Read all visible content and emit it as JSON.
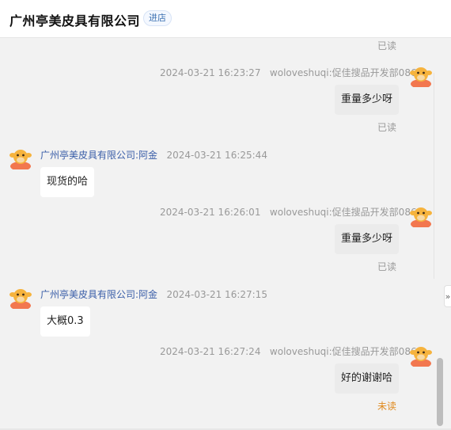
{
  "header": {
    "shop_name": "广州亭美皮具有限公司",
    "enter_shop_label": "进店"
  },
  "messages": [
    {
      "direction": "out",
      "status": "已读"
    },
    {
      "direction": "out",
      "time": "2024-03-21 16:23:27",
      "sender": "woloveshuqi:促佳搜品开发部086",
      "text": "重量多少呀",
      "status": "已读"
    },
    {
      "direction": "in",
      "sender": "广州亭美皮具有限公司:阿金",
      "time": "2024-03-21 16:25:44",
      "text": "现货的哈"
    },
    {
      "direction": "out",
      "time": "2024-03-21 16:26:01",
      "sender": "woloveshuqi:促佳搜品开发部086",
      "text": "重量多少呀",
      "status": "已读"
    },
    {
      "direction": "in",
      "sender": "广州亭美皮具有限公司:阿金",
      "time": "2024-03-21 16:27:15",
      "text": "大概0.3"
    },
    {
      "direction": "out",
      "time": "2024-03-21 16:27:24",
      "sender": "woloveshuqi:促佳搜品开发部086",
      "text": "好的谢谢哈",
      "status": "未读"
    }
  ],
  "colors": {
    "status_unread": "#e08a1e",
    "shop_sender": "#3a5ea8",
    "avatar_orange": "#f2774f"
  },
  "icons": {
    "avatar": "cow-avatar-icon",
    "collapse": "double-chevron-icon"
  },
  "collapse_glyph": "»"
}
